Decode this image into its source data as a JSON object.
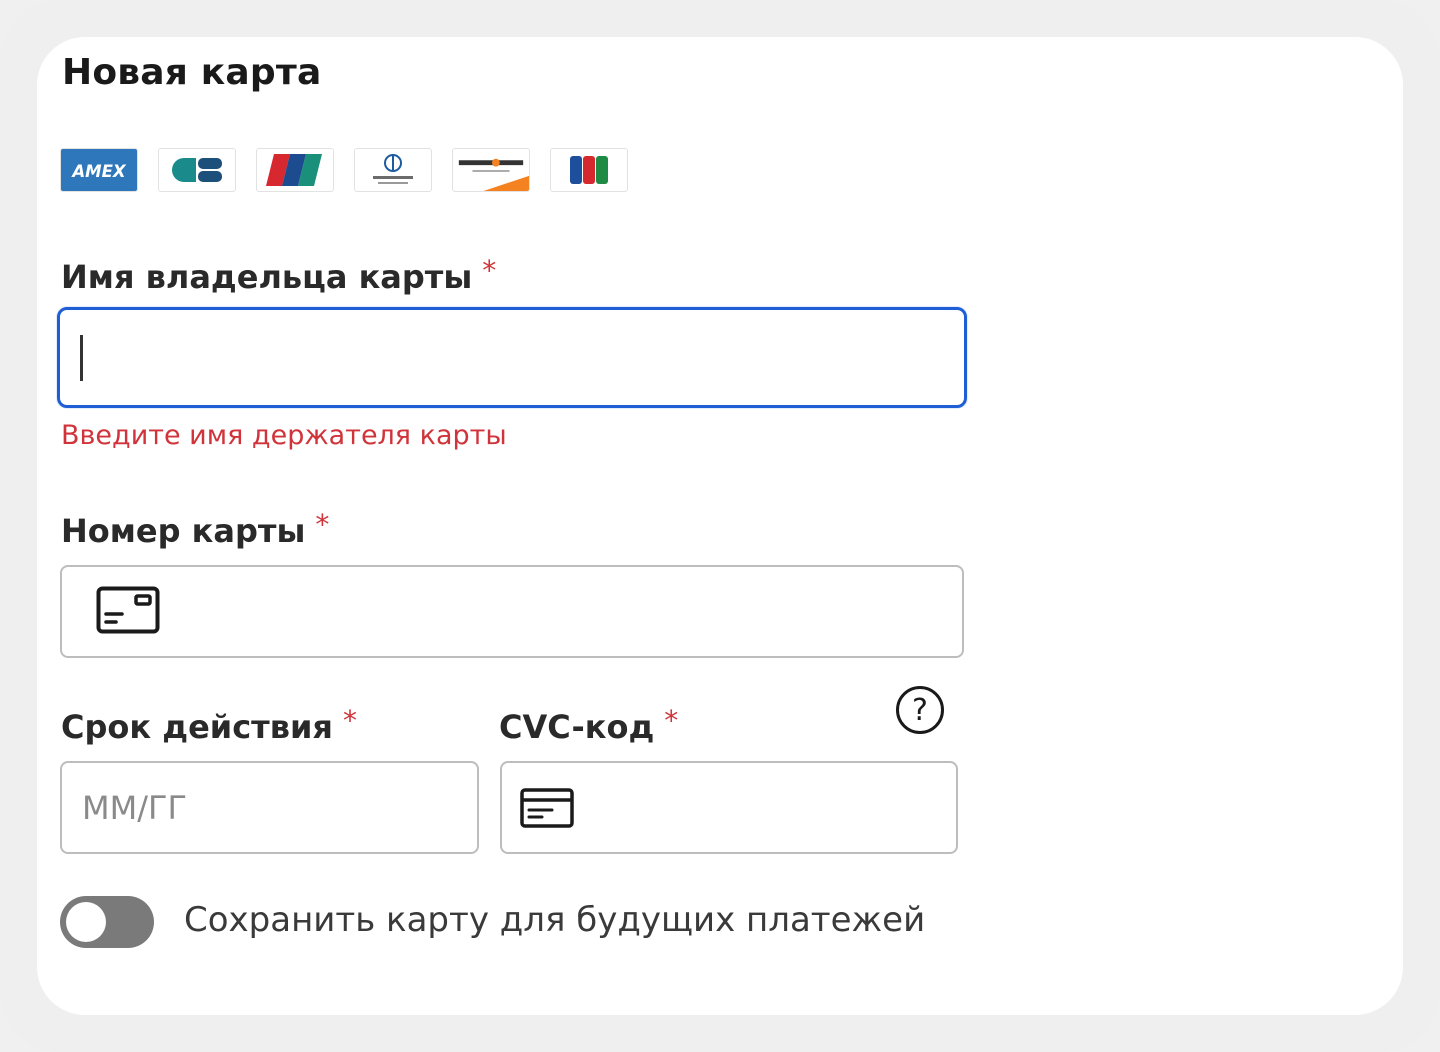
{
  "form": {
    "title": "Новая карта",
    "card_brands": [
      {
        "name": "AMEX",
        "icon": "amex-logo-icon"
      },
      {
        "name": "CB",
        "icon": "cb-logo-icon"
      },
      {
        "name": "UnionPay",
        "icon": "unionpay-logo-icon"
      },
      {
        "name": "Diners Club",
        "icon": "diners-club-logo-icon"
      },
      {
        "name": "DISCOVER",
        "icon": "discover-logo-icon"
      },
      {
        "name": "JCB",
        "icon": "jcb-logo-icon"
      }
    ],
    "cardholder": {
      "label": "Имя владельца карты",
      "required_mark": "*",
      "value": "",
      "error": "Введите имя держателя карты"
    },
    "card_number": {
      "label": "Номер карты",
      "required_mark": "*",
      "value": "",
      "icon": "credit-card-icon"
    },
    "expiry": {
      "label": "Срок действия",
      "required_mark": "*",
      "placeholder": "ММ/ГГ",
      "value": ""
    },
    "cvc": {
      "label": "CVC-код",
      "required_mark": "*",
      "value": "",
      "icon": "card-back-icon",
      "help_glyph": "?"
    },
    "save_card": {
      "label": "Сохранить карту для будущих платежей",
      "enabled": false
    }
  },
  "colors": {
    "focus_border": "#1f5fd6",
    "error": "#d0343a",
    "toggle_off": "#7a7a7a"
  }
}
